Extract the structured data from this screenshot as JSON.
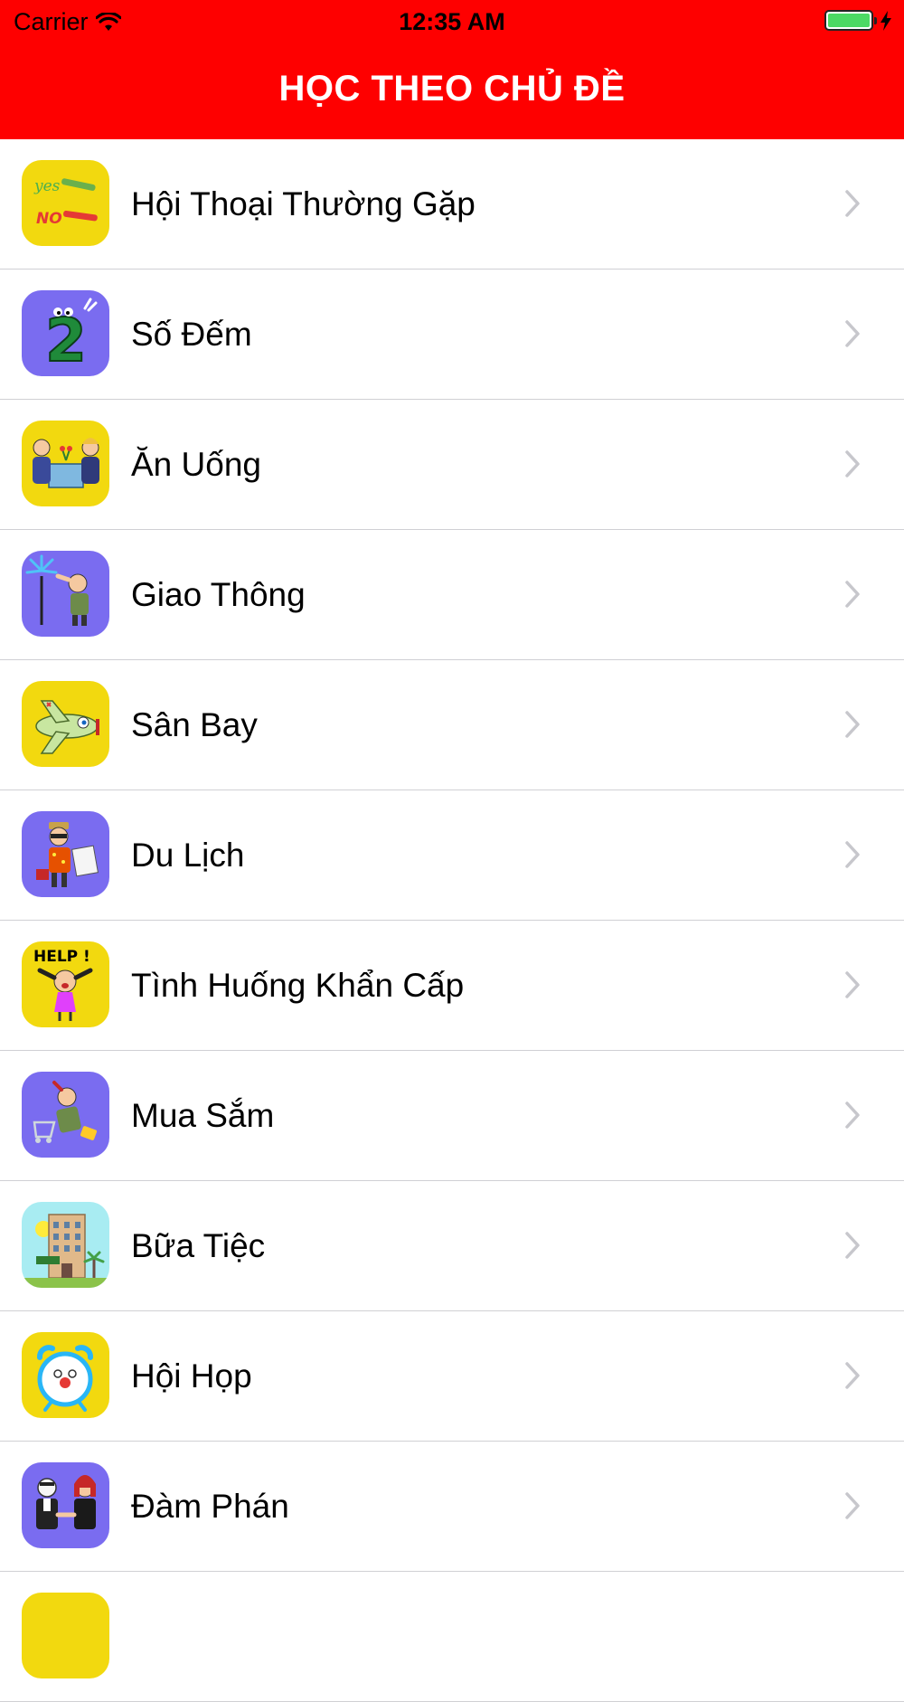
{
  "status_bar": {
    "carrier": "Carrier",
    "time": "12:35 AM",
    "battery_color": "#4cd964"
  },
  "nav": {
    "title": "HỌC THEO CHỦ ĐỀ",
    "background": "#fe0000"
  },
  "topics": [
    {
      "label": "Hội Thoại Thường Gặp",
      "icon": "yes-no-icon",
      "icon_bg": "#f2d90f"
    },
    {
      "label": "Số Đếm",
      "icon": "number-two-icon",
      "icon_bg": "#7a6cf0"
    },
    {
      "label": "Ăn Uống",
      "icon": "dining-icon",
      "icon_bg": "#f2d90f"
    },
    {
      "label": "Giao Thông",
      "icon": "traffic-icon",
      "icon_bg": "#7a6cf0"
    },
    {
      "label": "Sân Bay",
      "icon": "airplane-icon",
      "icon_bg": "#f2d90f"
    },
    {
      "label": "Du Lịch",
      "icon": "traveler-icon",
      "icon_bg": "#7a6cf0"
    },
    {
      "label": "Tình Huống Khẩn Cấp",
      "icon": "help-icon",
      "icon_bg": "#f2d90f"
    },
    {
      "label": "Mua Sắm",
      "icon": "shopping-icon",
      "icon_bg": "#7a6cf0"
    },
    {
      "label": "Bữa Tiệc",
      "icon": "hotel-icon",
      "icon_bg": "#a8ecf2"
    },
    {
      "label": "Hội Họp",
      "icon": "alarm-clock-icon",
      "icon_bg": "#f2d90f"
    },
    {
      "label": "Đàm Phán",
      "icon": "negotiation-icon",
      "icon_bg": "#7a6cf0"
    },
    {
      "label": "",
      "icon": "partial-icon",
      "icon_bg": "#f2d90f"
    }
  ]
}
